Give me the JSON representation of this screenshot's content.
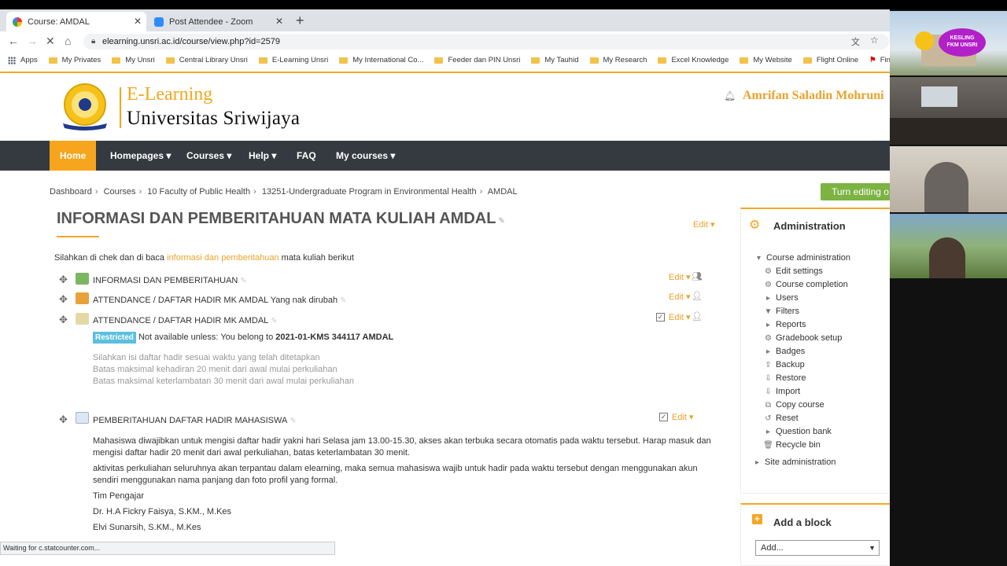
{
  "browser": {
    "tabs": [
      {
        "title": "Course: AMDAL",
        "active": true
      },
      {
        "title": "Post Attendee - Zoom",
        "active": false
      }
    ],
    "url": "elearning.unsri.ac.id/course/view.php?id=2579",
    "bookmarks": [
      "Apps",
      "My Privates",
      "My Unsri",
      "Central Library Unsri",
      "E-Learning Unsri",
      "My International Co...",
      "Feeder dan PIN Unsri",
      "My Tauhid",
      "My Research",
      "Excel Knowledge",
      "My Website",
      "Flight Online",
      "Finite Element A"
    ],
    "status": "Waiting for c.statcounter.com..."
  },
  "site": {
    "logo_line1": "E-Learning",
    "logo_line2": "Universitas  Sriwijaya",
    "user": "Amrifan Saladin Mohruni"
  },
  "nav": [
    "Home",
    "Homepages ▾",
    "Courses ▾",
    "Help ▾",
    "FAQ",
    "My courses ▾"
  ],
  "breadcrumb": [
    "Dashboard",
    "Courses",
    "10 Faculty of Public Health",
    "13251-Undergraduate Program in Environmental Health",
    "AMDAL"
  ],
  "turn_editing": "Turn editing o",
  "section": {
    "title": "INFORMASI DAN PEMBERITAHUAN MATA KULIAH AMDAL",
    "edit": "Edit ▾",
    "intro_before": "Silahkan di chek dan di baca ",
    "intro_link": "informasi dan pemberitahuan",
    "intro_after": " mata kuliah berikut"
  },
  "activities": [
    {
      "name": "INFORMASI DAN PEMBERITAHUAN",
      "edit": "Edit ▾"
    },
    {
      "name": "ATTENDANCE / DAFTAR HADIR MK AMDAL Yang nak dirubah",
      "edit": "Edit ▾"
    },
    {
      "name": "ATTENDANCE / DAFTAR HADIR MK AMDAL",
      "edit": "Edit ▾"
    },
    {
      "name": "PEMBERITAHUAN DAFTAR HADIR MAHASISWA",
      "edit": "Edit ▾"
    }
  ],
  "restriction": {
    "badge": "Restricted",
    "text": " Not available unless: You belong to ",
    "group": "2021-01-KMS 344117 AMDAL"
  },
  "attendance_notes": [
    "Silahkan isi daftar hadir sesuai waktu yang telah ditetapkan",
    "Batas maksimal kehadiran 20 menit dari awal mulai perkuliahan",
    "Batas maksimal keterlambatan 30 menit dari awal mulai perkuliahan"
  ],
  "notice": {
    "p1": "Mahasiswa diwajibkan untuk mengisi daftar hadir yakni hari Selasa jam 13.00-15.30, akses akan terbuka secara otomatis pada waktu tersebut. Harap masuk dan mengisi daftar hadir 20 menit dari awal perkuliahan, batas keterlambatan 30 menit.",
    "p2": "aktivitas perkuliahan seluruhnya akan terpantau dalam elearning, maka semua mahasiswa wajib untuk hadir pada waktu tersebut dengan menggunakan akun sendiri menggunakan nama panjang dan foto profil yang formal.",
    "p3": "Tim Pengajar",
    "p4": "Dr. H.A Fickry Faisya, S.KM., M.Kes",
    "p5": "Elvi Sunarsih, S.KM., M.Kes"
  },
  "admin": {
    "title": "Administration",
    "course_admin": "Course administration",
    "items": [
      "Edit settings",
      "Course completion",
      "Users",
      "Filters",
      "Reports",
      "Gradebook setup",
      "Badges",
      "Backup",
      "Restore",
      "Import",
      "Copy course",
      "Reset",
      "Question bank",
      "Recycle bin"
    ],
    "site_admin": "Site administration"
  },
  "add_block": {
    "title": "Add a block",
    "select": "Add..."
  },
  "video": {
    "badge_line1": "KESLING",
    "badge_line2": "FKM UNSRI"
  },
  "colors": {
    "accent": "#f6a623",
    "nav": "#343a40",
    "turn_edit": "#7cb342",
    "restricted": "#5bc0de"
  }
}
